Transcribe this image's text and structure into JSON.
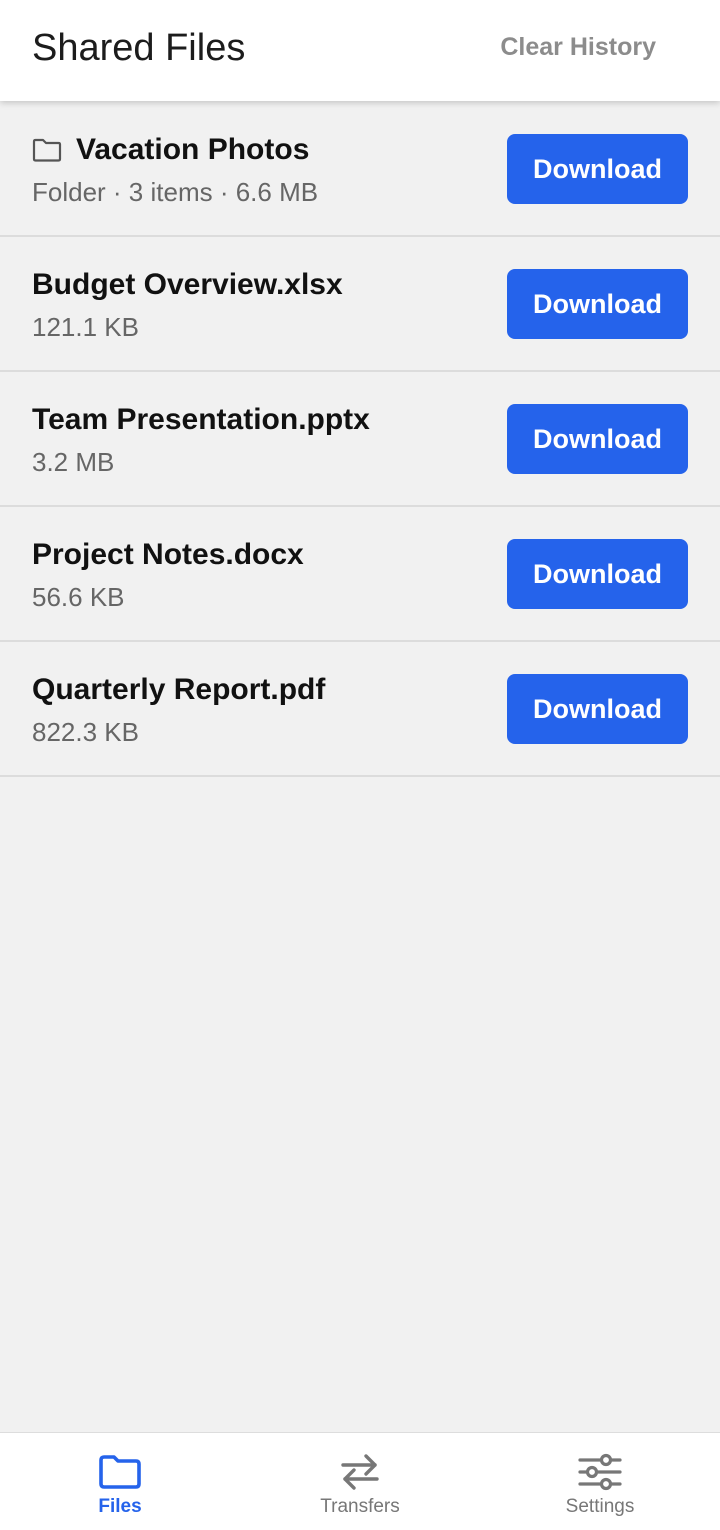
{
  "app_bar": {
    "title": "Shared Files",
    "clear_history_label": "Clear History"
  },
  "colors": {
    "accent": "#2563eb",
    "background": "#f1f1f1",
    "muted_text": "#666666"
  },
  "files": [
    {
      "name": "Vacation Photos",
      "meta": "Folder · 3 items · 6.6 MB",
      "icon": "folder-icon",
      "download_label": "Download"
    },
    {
      "name": "Budget Overview.xlsx",
      "meta": "121.1 KB",
      "download_label": "Download"
    },
    {
      "name": "Team Presentation.pptx",
      "meta": "3.2 MB",
      "download_label": "Download"
    },
    {
      "name": "Project Notes.docx",
      "meta": "56.6 KB",
      "download_label": "Download"
    },
    {
      "name": "Quarterly Report.pdf",
      "meta": "822.3 KB",
      "download_label": "Download"
    }
  ],
  "bottom_nav": {
    "active": "Files",
    "items": [
      {
        "label": "Files",
        "icon": "folder-icon"
      },
      {
        "label": "Transfers",
        "icon": "transfer-arrows-icon"
      },
      {
        "label": "Settings",
        "icon": "sliders-icon"
      }
    ]
  }
}
